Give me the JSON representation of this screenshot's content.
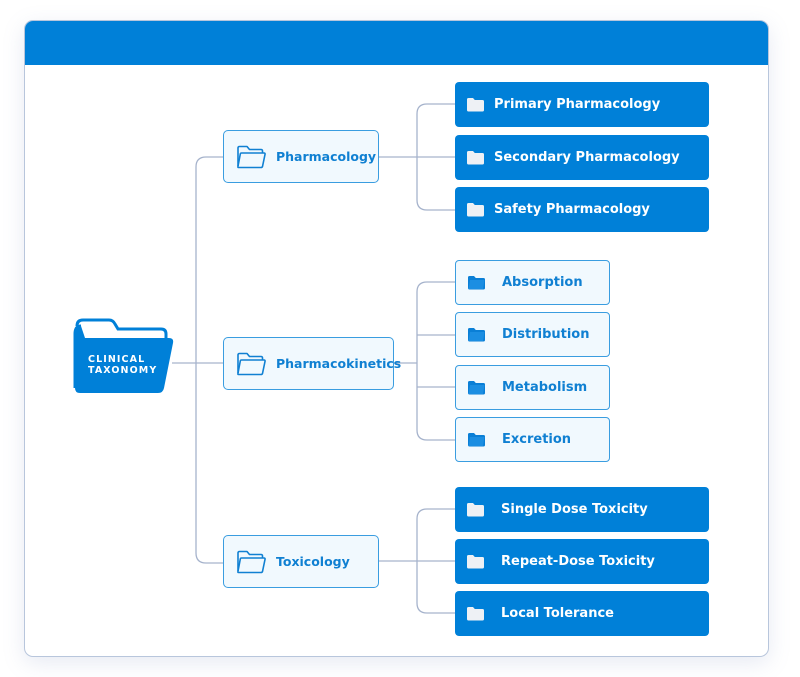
{
  "header": {
    "title": ""
  },
  "colors": {
    "brand_blue": "#0080d8",
    "outline_blue": "#3a9de0",
    "text_blue": "#1080d2",
    "light_fill": "#f1f9fe",
    "connector": "#a6b3cc"
  },
  "root": {
    "label_line1": "CLINICAL",
    "label_line2": "TAXONOMY",
    "icon": "folder-icon"
  },
  "categories": [
    {
      "label": "Pharmacology",
      "icon": "folder-outline-icon",
      "children": [
        {
          "label": "Primary Pharmacology",
          "style": "solid",
          "icon": "folder-icon"
        },
        {
          "label": "Secondary Pharmacology",
          "style": "solid",
          "icon": "folder-icon"
        },
        {
          "label": "Safety Pharmacology",
          "style": "solid",
          "icon": "folder-icon"
        }
      ]
    },
    {
      "label": "Pharmacokinetics",
      "icon": "folder-outline-icon",
      "children": [
        {
          "label": "Absorption",
          "style": "outline",
          "icon": "folder-icon"
        },
        {
          "label": "Distribution",
          "style": "outline",
          "icon": "folder-icon"
        },
        {
          "label": "Metabolism",
          "style": "outline",
          "icon": "folder-icon"
        },
        {
          "label": "Excretion",
          "style": "outline",
          "icon": "folder-icon"
        }
      ]
    },
    {
      "label": "Toxicology",
      "icon": "folder-outline-icon",
      "children": [
        {
          "label": "Single Dose Toxicity",
          "style": "solid",
          "icon": "folder-icon"
        },
        {
          "label": "Repeat-Dose Toxicity",
          "style": "solid",
          "icon": "folder-icon"
        },
        {
          "label": "Local Tolerance",
          "style": "solid",
          "icon": "folder-icon"
        }
      ]
    }
  ]
}
